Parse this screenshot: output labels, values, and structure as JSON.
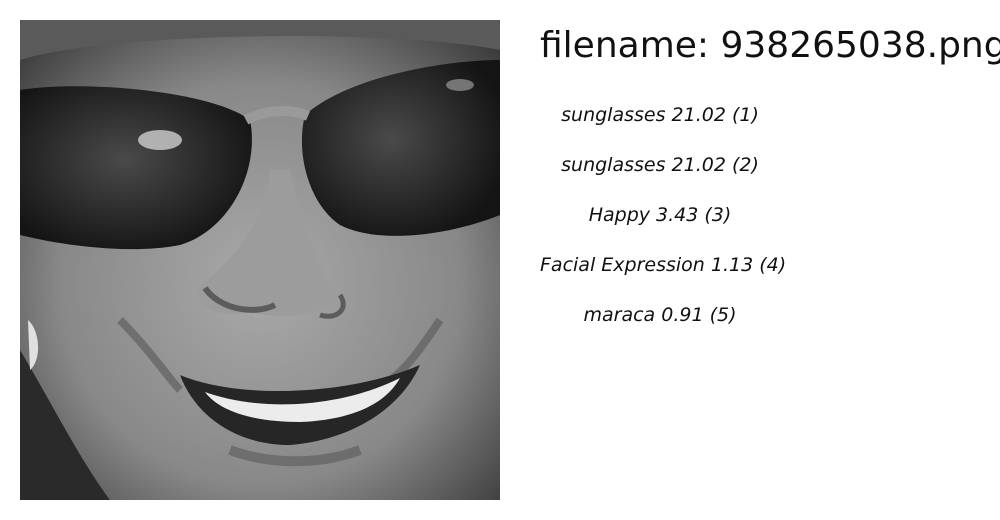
{
  "header": {
    "filename": "filename: 938265038.png"
  },
  "predictions": [
    "sunglasses 21.02 (1)",
    "sunglasses 21.02 (2)",
    "Happy  3.43 (3)",
    "Facial Expression  1.13 (4)",
    "maraca  0.91 (5)"
  ]
}
